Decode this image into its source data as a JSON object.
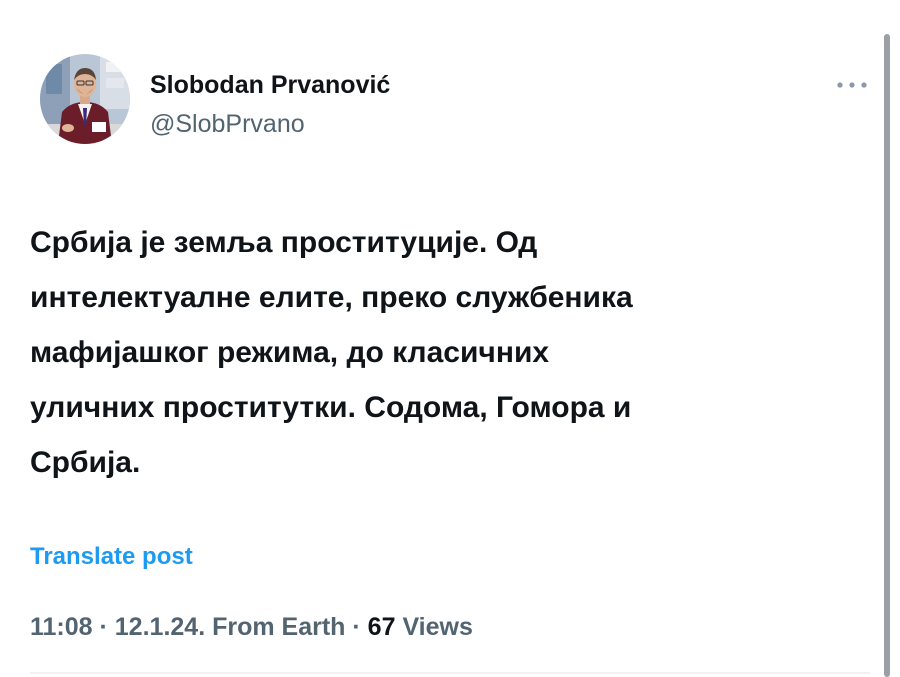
{
  "author": {
    "display_name": "Slobodan Prvanović",
    "handle": "@SlobPrvano",
    "avatar_icon": "person-avatar-icon"
  },
  "tweet": {
    "text": "Србија је земља проституције. Од\nинтелектуалне елите, преко службеника\nмафијашког режима, до класичних\nуличних проститутки. Содома, Гомора и\nСрбија."
  },
  "translate_label": "Translate post",
  "meta": {
    "time": "11:08",
    "separator": " · ",
    "date": "12.1.24.",
    "source": "From Earth",
    "views_count": "67",
    "views_label": "Views"
  },
  "colors": {
    "accent": "#1d9bf0",
    "text_primary": "#0f1419",
    "text_secondary": "#536471",
    "scrollbar": "#9aa0a6"
  }
}
